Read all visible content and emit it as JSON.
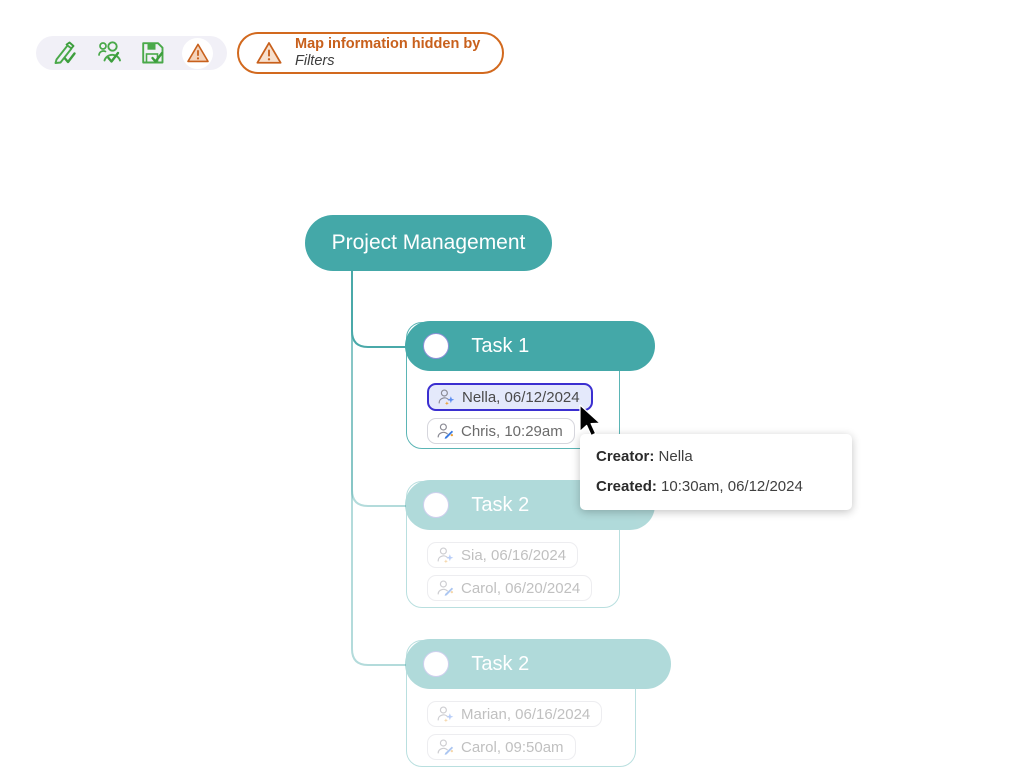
{
  "toolbar": {
    "buttons": [
      {
        "name": "edit-check",
        "icon": "pen-check-icon",
        "label": "Edit"
      },
      {
        "name": "collaborators-check",
        "icon": "people-check-icon",
        "label": "Collaborators"
      },
      {
        "name": "save-check",
        "icon": "save-check-icon",
        "label": "Save"
      },
      {
        "name": "warning",
        "icon": "warning-triangle-icon",
        "label": "Warning"
      }
    ]
  },
  "alert": {
    "icon": "warning-triangle-icon",
    "line1": "Map information hidden by",
    "line2": "Filters",
    "border_color": "#d2691e",
    "text_color": "#c8601c"
  },
  "map": {
    "root": {
      "label": "Project Management",
      "color": "#44a8a8"
    },
    "nodes": [
      {
        "title": "Task 1",
        "dimmed": false,
        "badges": [
          {
            "icon": "person-sparkle-icon",
            "label": "Nella, 06/12/2024",
            "selected": true
          },
          {
            "icon": "person-pencil-icon",
            "label": "Chris, 10:29am",
            "selected": false
          }
        ]
      },
      {
        "title": "Task 2",
        "dimmed": true,
        "badges": [
          {
            "icon": "person-sparkle-icon",
            "label": "Sia, 06/16/2024",
            "selected": false
          },
          {
            "icon": "person-pencil-icon",
            "label": "Carol, 06/20/2024",
            "selected": false
          }
        ]
      },
      {
        "title": "Task 2",
        "dimmed": true,
        "badges": [
          {
            "icon": "person-sparkle-icon",
            "label": "Marian, 06/16/2024",
            "selected": false
          },
          {
            "icon": "person-pencil-icon",
            "label": "Carol, 09:50am",
            "selected": false
          }
        ]
      }
    ]
  },
  "tooltip": {
    "creator_key": "Creator:",
    "creator_value": "Nella",
    "created_key": "Created:",
    "created_value": "10:30am, 06/12/2024"
  }
}
